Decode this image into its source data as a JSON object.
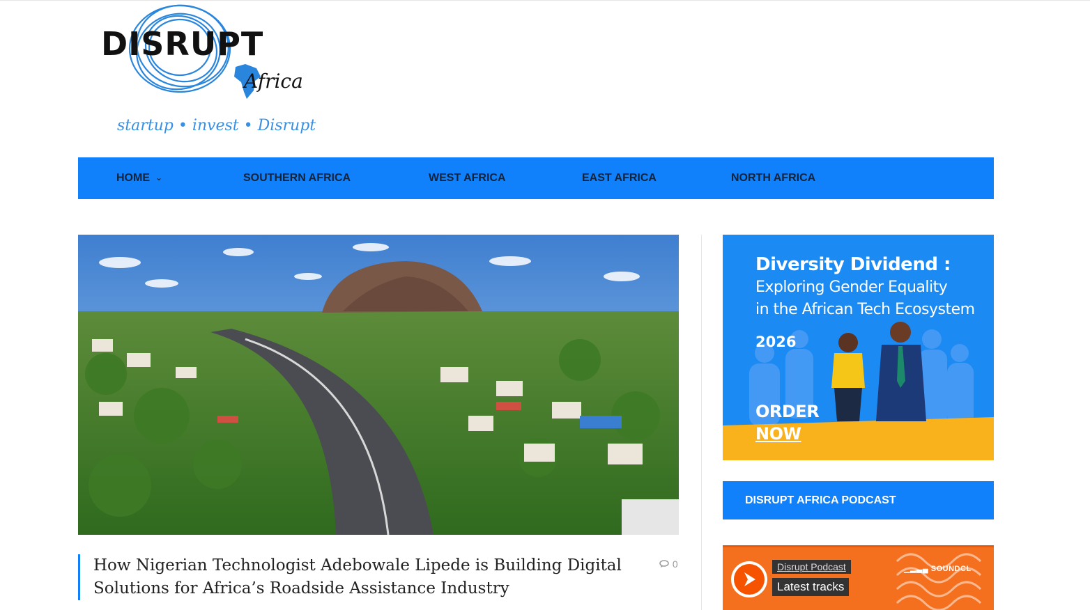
{
  "site": {
    "logo_word": "DISRUPT",
    "logo_sub": "Africa",
    "tagline": "startup • invest • Disrupt"
  },
  "nav": {
    "items": [
      {
        "label": "HOME",
        "dropdown": true
      },
      {
        "label": "SOUTHERN AFRICA"
      },
      {
        "label": "WEST AFRICA"
      },
      {
        "label": "EAST AFRICA"
      },
      {
        "label": "NORTH AFRICA"
      }
    ]
  },
  "article": {
    "headline": "How Nigerian Technologist Adebowale Lipede is Building Digital Solutions for Africa’s Roadside Assistance Industry",
    "comment_count": "0",
    "comment_icon": "comments-icon"
  },
  "sidebar": {
    "ad": {
      "title": "Diversity Dividend :",
      "subtitle_line1": "Exploring Gender Equality",
      "subtitle_line2": "in the African Tech Ecosystem",
      "year": "2026",
      "cta_line1": "ORDER",
      "cta_line2": "NOW"
    },
    "podcast_heading": "DISRUPT AFRICA PODCAST",
    "podcast": {
      "name": "Disrupt Podcast",
      "tracks_label": "Latest tracks",
      "provider": "SOUNDCL"
    }
  },
  "colors": {
    "brand_blue": "#1081fa",
    "nav_text": "#15233b",
    "ad_blue": "#1c8af3",
    "ad_yellow": "#f9b21c",
    "soundcloud_orange": "#f4701f"
  }
}
